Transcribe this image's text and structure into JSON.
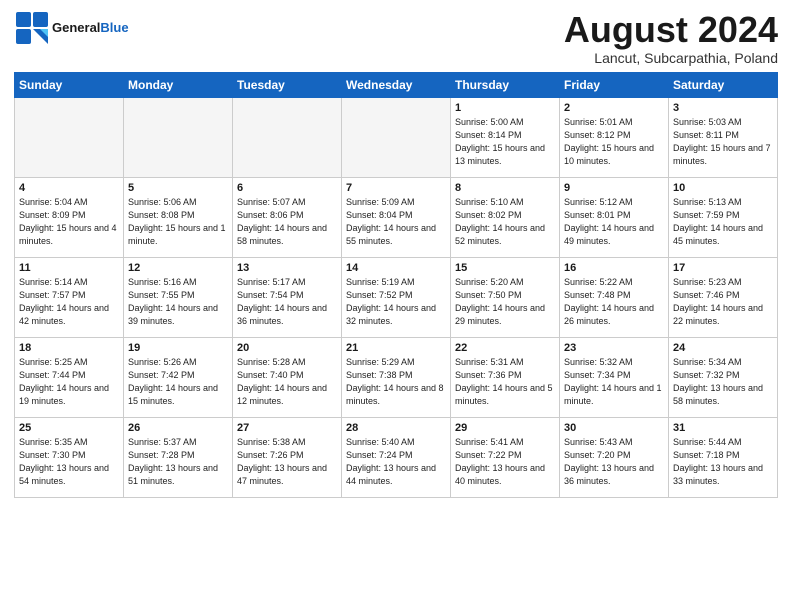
{
  "header": {
    "logo_text_general": "General",
    "logo_text_blue": "Blue",
    "month_title": "August 2024",
    "subtitle": "Lancut, Subcarpathia, Poland"
  },
  "days_of_week": [
    "Sunday",
    "Monday",
    "Tuesday",
    "Wednesday",
    "Thursday",
    "Friday",
    "Saturday"
  ],
  "weeks": [
    [
      {
        "num": "",
        "info": ""
      },
      {
        "num": "",
        "info": ""
      },
      {
        "num": "",
        "info": ""
      },
      {
        "num": "",
        "info": ""
      },
      {
        "num": "1",
        "info": "Sunrise: 5:00 AM\nSunset: 8:14 PM\nDaylight: 15 hours\nand 13 minutes."
      },
      {
        "num": "2",
        "info": "Sunrise: 5:01 AM\nSunset: 8:12 PM\nDaylight: 15 hours\nand 10 minutes."
      },
      {
        "num": "3",
        "info": "Sunrise: 5:03 AM\nSunset: 8:11 PM\nDaylight: 15 hours\nand 7 minutes."
      }
    ],
    [
      {
        "num": "4",
        "info": "Sunrise: 5:04 AM\nSunset: 8:09 PM\nDaylight: 15 hours\nand 4 minutes."
      },
      {
        "num": "5",
        "info": "Sunrise: 5:06 AM\nSunset: 8:08 PM\nDaylight: 15 hours\nand 1 minute."
      },
      {
        "num": "6",
        "info": "Sunrise: 5:07 AM\nSunset: 8:06 PM\nDaylight: 14 hours\nand 58 minutes."
      },
      {
        "num": "7",
        "info": "Sunrise: 5:09 AM\nSunset: 8:04 PM\nDaylight: 14 hours\nand 55 minutes."
      },
      {
        "num": "8",
        "info": "Sunrise: 5:10 AM\nSunset: 8:02 PM\nDaylight: 14 hours\nand 52 minutes."
      },
      {
        "num": "9",
        "info": "Sunrise: 5:12 AM\nSunset: 8:01 PM\nDaylight: 14 hours\nand 49 minutes."
      },
      {
        "num": "10",
        "info": "Sunrise: 5:13 AM\nSunset: 7:59 PM\nDaylight: 14 hours\nand 45 minutes."
      }
    ],
    [
      {
        "num": "11",
        "info": "Sunrise: 5:14 AM\nSunset: 7:57 PM\nDaylight: 14 hours\nand 42 minutes."
      },
      {
        "num": "12",
        "info": "Sunrise: 5:16 AM\nSunset: 7:55 PM\nDaylight: 14 hours\nand 39 minutes."
      },
      {
        "num": "13",
        "info": "Sunrise: 5:17 AM\nSunset: 7:54 PM\nDaylight: 14 hours\nand 36 minutes."
      },
      {
        "num": "14",
        "info": "Sunrise: 5:19 AM\nSunset: 7:52 PM\nDaylight: 14 hours\nand 32 minutes."
      },
      {
        "num": "15",
        "info": "Sunrise: 5:20 AM\nSunset: 7:50 PM\nDaylight: 14 hours\nand 29 minutes."
      },
      {
        "num": "16",
        "info": "Sunrise: 5:22 AM\nSunset: 7:48 PM\nDaylight: 14 hours\nand 26 minutes."
      },
      {
        "num": "17",
        "info": "Sunrise: 5:23 AM\nSunset: 7:46 PM\nDaylight: 14 hours\nand 22 minutes."
      }
    ],
    [
      {
        "num": "18",
        "info": "Sunrise: 5:25 AM\nSunset: 7:44 PM\nDaylight: 14 hours\nand 19 minutes."
      },
      {
        "num": "19",
        "info": "Sunrise: 5:26 AM\nSunset: 7:42 PM\nDaylight: 14 hours\nand 15 minutes."
      },
      {
        "num": "20",
        "info": "Sunrise: 5:28 AM\nSunset: 7:40 PM\nDaylight: 14 hours\nand 12 minutes."
      },
      {
        "num": "21",
        "info": "Sunrise: 5:29 AM\nSunset: 7:38 PM\nDaylight: 14 hours\nand 8 minutes."
      },
      {
        "num": "22",
        "info": "Sunrise: 5:31 AM\nSunset: 7:36 PM\nDaylight: 14 hours\nand 5 minutes."
      },
      {
        "num": "23",
        "info": "Sunrise: 5:32 AM\nSunset: 7:34 PM\nDaylight: 14 hours\nand 1 minute."
      },
      {
        "num": "24",
        "info": "Sunrise: 5:34 AM\nSunset: 7:32 PM\nDaylight: 13 hours\nand 58 minutes."
      }
    ],
    [
      {
        "num": "25",
        "info": "Sunrise: 5:35 AM\nSunset: 7:30 PM\nDaylight: 13 hours\nand 54 minutes."
      },
      {
        "num": "26",
        "info": "Sunrise: 5:37 AM\nSunset: 7:28 PM\nDaylight: 13 hours\nand 51 minutes."
      },
      {
        "num": "27",
        "info": "Sunrise: 5:38 AM\nSunset: 7:26 PM\nDaylight: 13 hours\nand 47 minutes."
      },
      {
        "num": "28",
        "info": "Sunrise: 5:40 AM\nSunset: 7:24 PM\nDaylight: 13 hours\nand 44 minutes."
      },
      {
        "num": "29",
        "info": "Sunrise: 5:41 AM\nSunset: 7:22 PM\nDaylight: 13 hours\nand 40 minutes."
      },
      {
        "num": "30",
        "info": "Sunrise: 5:43 AM\nSunset: 7:20 PM\nDaylight: 13 hours\nand 36 minutes."
      },
      {
        "num": "31",
        "info": "Sunrise: 5:44 AM\nSunset: 7:18 PM\nDaylight: 13 hours\nand 33 minutes."
      }
    ]
  ]
}
